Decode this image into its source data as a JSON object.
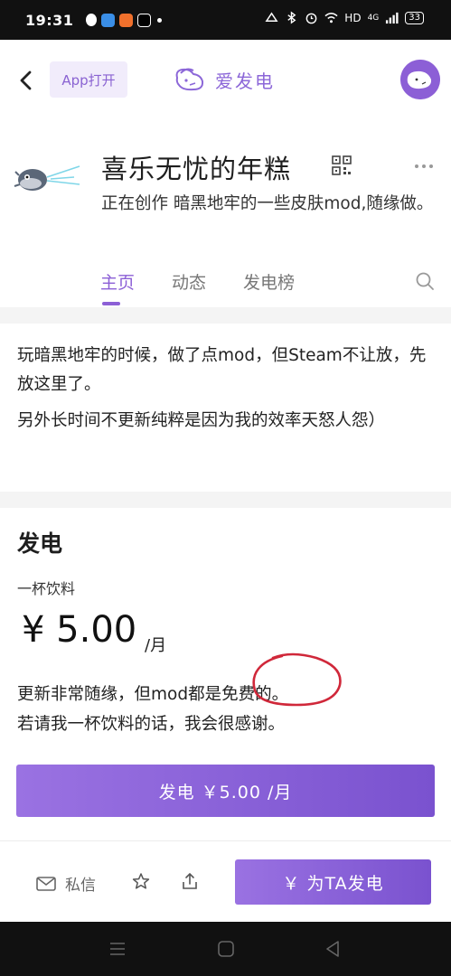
{
  "status_bar": {
    "time": "19:31",
    "network": "HD",
    "signal": "4G",
    "battery": "33",
    "app_icons": [
      "qq-icon",
      "browser-icon",
      "taobao-icon",
      "tiktok-icon"
    ]
  },
  "header": {
    "app_open_label": "App打开",
    "brand": "爱发电"
  },
  "profile": {
    "name": "喜乐无忧的年糕",
    "description": "正在创作 暗黑地牢的一些皮肤mod,随缘做。"
  },
  "tabs": [
    {
      "label": "主页",
      "active": true
    },
    {
      "label": "动态",
      "active": false
    },
    {
      "label": "发电榜",
      "active": false
    }
  ],
  "intro": {
    "paragraph1": "玩暗黑地牢的时候，做了点mod，但Steam不让放，先放这里了。",
    "paragraph2": "另外长时间不更新纯粹是因为我的效率天怒人怨）"
  },
  "donate": {
    "title": "发电",
    "tier_name": "一杯饮料",
    "price": "¥ 5.00",
    "price_unit": "/月",
    "desc_line1": "更新非常随缘，但mod都是免费的。",
    "desc_line2": "若请我一杯饮料的话，我会很感谢。",
    "button_label": "发电 ￥5.00 /月"
  },
  "bottom_bar": {
    "message_label": "私信",
    "cta_label": "￥ 为TA发电"
  },
  "colors": {
    "accent": "#8c5fd6",
    "accent_light": "#f1ecfb",
    "annotation_circle": "#d0283a"
  }
}
